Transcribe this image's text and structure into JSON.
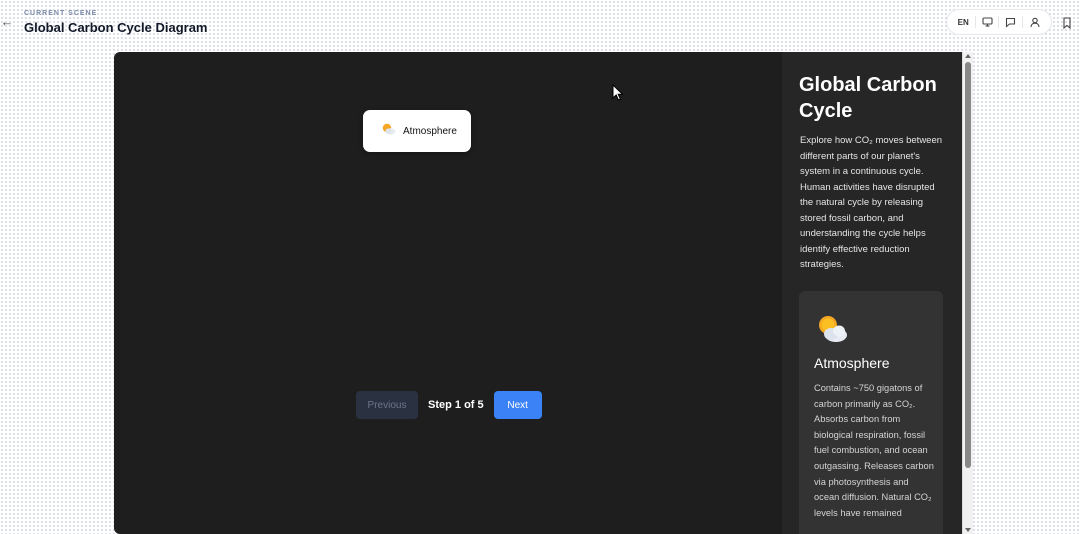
{
  "header": {
    "kicker": "CURRENT SCENE",
    "title": "Global Carbon Cycle Diagram",
    "language": "EN"
  },
  "icons": {
    "back": "arrow-left-icon",
    "monitor": "monitor-icon",
    "comment": "comment-icon",
    "user": "user-icon",
    "bookmark": "bookmark-icon",
    "atmosphere": "sun-behind-cloud-icon"
  },
  "diagram": {
    "node_label": "Atmosphere"
  },
  "controls": {
    "previous": "Previous",
    "step": "Step 1 of 5",
    "next": "Next"
  },
  "panel": {
    "title": "Global Carbon Cycle",
    "description": "Explore how CO₂ moves between different parts of our planet's system in a continuous cycle. Human activities have disrupted the natural cycle by releasing stored fossil carbon, and understanding the cycle helps identify effective reduction strategies.",
    "card": {
      "title": "Atmosphere",
      "text": "Contains ~750 gigatons of carbon primarily as CO₂. Absorbs carbon from biological respiration, fossil fuel combustion, and ocean outgassing. Releases carbon via photosynthesis and ocean diffusion. Natural CO₂ levels have remained"
    }
  },
  "colors": {
    "stage_bg": "#1e1e1e",
    "panel_bg": "#262626",
    "card_bg": "#333333",
    "accent": "#3b82f6"
  }
}
